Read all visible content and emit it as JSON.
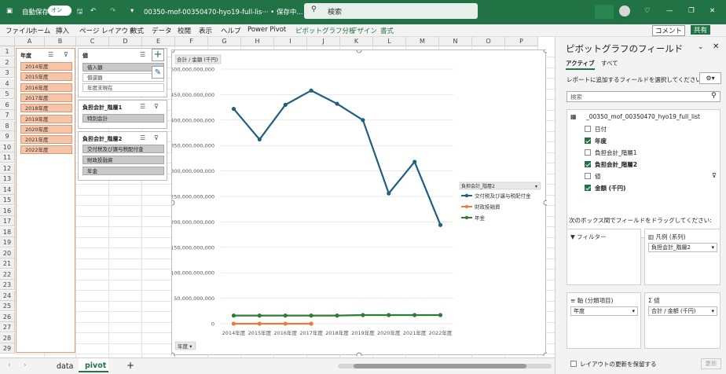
{
  "titlebar": {
    "autosave_label": "自動保存",
    "autosave_state": "オン",
    "filename": "00350-mof-00350470-hyo19-full-lis··· • 保存中...",
    "search_placeholder": "検索"
  },
  "menu": [
    "ファイル",
    "ホーム",
    "挿入",
    "ページ レイアウト",
    "数式",
    "データ",
    "校閲",
    "表示",
    "ヘルプ",
    "Power Pivot",
    "ピボットグラフ分析",
    "デザイン",
    "書式"
  ],
  "menu_right": {
    "comment": "コメント",
    "share": "共有"
  },
  "columns": [
    "A",
    "B",
    "C",
    "D",
    "E",
    "F",
    "G",
    "H",
    "I",
    "J",
    "K",
    "L",
    "M",
    "N",
    "O",
    "P"
  ],
  "rows": [
    "1",
    "2",
    "3",
    "4",
    "5",
    "6",
    "7",
    "8",
    "9",
    "10",
    "11",
    "12",
    "13",
    "14",
    "15",
    "16",
    "17",
    "18",
    "19",
    "20",
    "21",
    "22",
    "23",
    "24",
    "25",
    "26",
    "27",
    "28",
    "29"
  ],
  "slicer_year": {
    "title": "年度",
    "items": [
      "2014年度",
      "2015年度",
      "2016年度",
      "2017年度",
      "2018年度",
      "2019年度",
      "2020年度",
      "2021年度",
      "2022年度"
    ]
  },
  "slicer_value": {
    "title": "値",
    "items": [
      "借入額",
      "償還額",
      "年度末現在"
    ]
  },
  "slicer_h1": {
    "title": "負担会計_階層1",
    "items": [
      "特別会計"
    ]
  },
  "slicer_h2": {
    "title": "負担会計_階層2",
    "items": [
      "交付税及び譲与税配付金",
      "財政投融資",
      "年金"
    ]
  },
  "chart_data": {
    "type": "line",
    "ylabel": "合計 / 金額 (千円)",
    "categories": [
      "2014年度",
      "2015年度",
      "2016年度",
      "2017年度",
      "2018年度",
      "2019年度",
      "2020年度",
      "2021年度",
      "2022年度"
    ],
    "y_ticks": [
      "0",
      "50,000,000,000",
      "100,000,000,000",
      "150,000,000,000",
      "200,000,000,000",
      "250,000,000,000",
      "300,000,000,000",
      "350,000,000,000",
      "400,000,000,000",
      "450,000,000,000",
      "500,000,000,000"
    ],
    "ylim": [
      0,
      500000000000
    ],
    "legend_title": "負担会計_階層2",
    "x_field": "年度",
    "series": [
      {
        "name": "交付税及び譲与税配付金",
        "color": "#1f5f7f",
        "values": [
          422000000000,
          362000000000,
          430000000000,
          458000000000,
          432000000000,
          400000000000,
          256000000000,
          318000000000,
          194000000000
        ]
      },
      {
        "name": "財政投融資",
        "color": "#e77d3a",
        "values": [
          0,
          0,
          0,
          0
        ]
      },
      {
        "name": "年金",
        "color": "#2e7d32",
        "values": [
          16000000000,
          16000000000,
          16000000000,
          16000000000,
          16000000000,
          17000000000,
          17000000000,
          17000000000,
          17000000000
        ]
      }
    ]
  },
  "sheets": {
    "tab1": "data",
    "tab2": "pivot",
    "add": "+"
  },
  "panel": {
    "title": "ピボットグラフのフィールド",
    "tab_active": "アクティブ",
    "tab_all": "すべて",
    "instruction": "レポートに追加するフィールドを選択してください:",
    "search": "検索",
    "table_name": "_00350_mof_00350470_hyo19_full_list",
    "fields": [
      "日付",
      "年度",
      "負担会計_階層1",
      "負担会計_階層2",
      "値",
      "金額 (千円)"
    ],
    "drag_text": "次のボックス間でフィールドをドラッグしてください:",
    "filter": "フィルター",
    "legend": "凡例 (系列)",
    "legend_item": "負担会計_階層2",
    "axis": "軸 (分類項目)",
    "axis_item": "年度",
    "values": "値",
    "values_item": "合計 / 金額 (千円)",
    "defer": "レイアウトの更新を保留する",
    "update": "更新"
  }
}
